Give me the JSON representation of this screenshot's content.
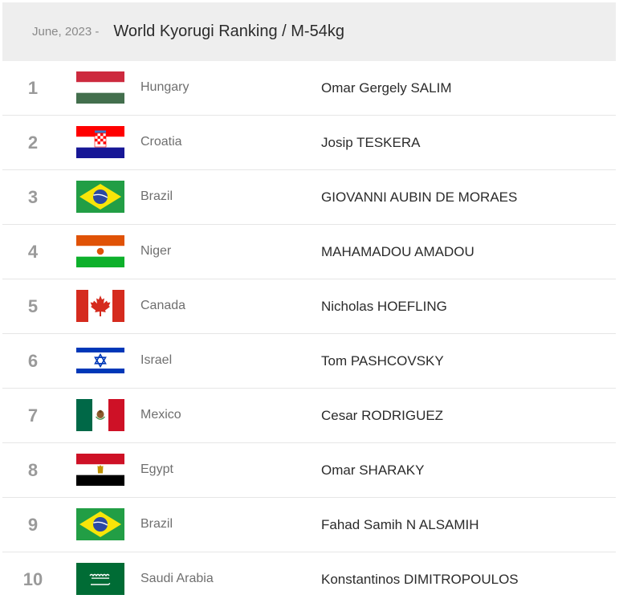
{
  "header": {
    "date": "June, 2023 -",
    "title": "World Kyorugi Ranking / M-54kg"
  },
  "rows": [
    {
      "rank": "1",
      "country": "Hungary",
      "athlete": "Omar Gergely SALIM",
      "flag_icon": "flag-hungary-icon"
    },
    {
      "rank": "2",
      "country": "Croatia",
      "athlete": "Josip TESKERA",
      "flag_icon": "flag-croatia-icon"
    },
    {
      "rank": "3",
      "country": "Brazil",
      "athlete": "GIOVANNI AUBIN DE MORAES",
      "flag_icon": "flag-brazil-icon"
    },
    {
      "rank": "4",
      "country": "Niger",
      "athlete": "MAHAMADOU AMADOU",
      "flag_icon": "flag-niger-icon"
    },
    {
      "rank": "5",
      "country": "Canada",
      "athlete": "Nicholas HOEFLING",
      "flag_icon": "flag-canada-icon"
    },
    {
      "rank": "6",
      "country": "Israel",
      "athlete": "Tom PASHCOVSKY",
      "flag_icon": "flag-israel-icon"
    },
    {
      "rank": "7",
      "country": "Mexico",
      "athlete": "Cesar RODRIGUEZ",
      "flag_icon": "flag-mexico-icon"
    },
    {
      "rank": "8",
      "country": "Egypt",
      "athlete": "Omar SHARAKY",
      "flag_icon": "flag-egypt-icon"
    },
    {
      "rank": "9",
      "country": "Brazil",
      "athlete": "Fahad Samih N ALSAMIH",
      "flag_icon": "flag-brazil-icon"
    },
    {
      "rank": "10",
      "country": "Saudi Arabia",
      "athlete": "Konstantinos DIMITROPOULOS",
      "flag_icon": "flag-saudi-arabia-icon"
    }
  ],
  "colors": {
    "header_bg": "#eeeeee",
    "rank": "#9a9a9a",
    "country": "#6f6f6f",
    "athlete": "#2b2b2b",
    "divider": "#e6e6e6"
  }
}
